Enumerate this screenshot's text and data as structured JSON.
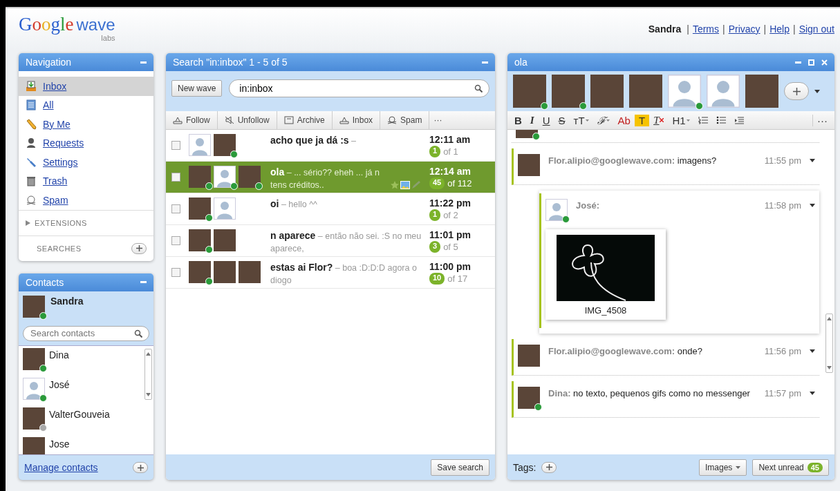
{
  "header": {
    "logo": {
      "brand": "Google",
      "product": "wave",
      "tag": "labs"
    },
    "user": "Sandra",
    "separator": "|",
    "links": [
      "Terms",
      "Privacy",
      "Help",
      "Sign out"
    ]
  },
  "navigation": {
    "title": "Navigation",
    "items": [
      {
        "label": "Inbox",
        "kind": "inbox",
        "selected": true
      },
      {
        "label": "All",
        "kind": "all",
        "selected": false
      },
      {
        "label": "By Me",
        "kind": "byme",
        "selected": false
      },
      {
        "label": "Requests",
        "kind": "requests",
        "selected": false
      },
      {
        "label": "Settings",
        "kind": "settings",
        "selected": false
      },
      {
        "label": "Trash",
        "kind": "trash",
        "selected": false
      },
      {
        "label": "Spam",
        "kind": "spam",
        "selected": false
      }
    ],
    "extensions": {
      "label": "EXTENSIONS",
      "expanded": false
    },
    "searches": "SEARCHES"
  },
  "contacts": {
    "title": "Contacts",
    "me": {
      "name": "Sandra",
      "kind": "photo",
      "online": true
    },
    "search_placeholder": "Search contacts",
    "list": [
      {
        "name": "Dina",
        "kind": "photo",
        "online": true
      },
      {
        "name": "José",
        "kind": "silhouette",
        "online": true
      },
      {
        "name": "ValterGouveia",
        "kind": "photo",
        "online": false
      },
      {
        "name": "Jose",
        "kind": "photo"
      }
    ],
    "manage_link": "Manage contacts"
  },
  "search": {
    "title": "Search \"in:inbox\" 1 - 5 of 5",
    "new_wave": "New wave",
    "query": "in:inbox",
    "toolbar": [
      {
        "label": "Follow",
        "kind": "follow"
      },
      {
        "label": "Unfollow",
        "kind": "unfollow"
      },
      {
        "label": "Archive",
        "kind": "archive"
      },
      {
        "label": "Inbox",
        "kind": "inbox"
      },
      {
        "label": "Spam",
        "kind": "spam"
      }
    ],
    "more": "···",
    "waves": [
      {
        "checked": false,
        "selected": false,
        "avatars": [
          {
            "kind": "silhouette",
            "online": false
          },
          {
            "kind": "photo",
            "online": true
          }
        ],
        "title": "acho que ja dá :s",
        "snippet": "–",
        "time": "12:11 am",
        "unread": "1",
        "total": "of 1"
      },
      {
        "checked": false,
        "selected": true,
        "avatars": [
          {
            "kind": "photo",
            "online": true
          },
          {
            "kind": "silhouette",
            "online": true
          },
          {
            "kind": "photo",
            "online": true
          }
        ],
        "title": "ola",
        "snippet": "– ... sério?? eheh ... já n tens créditos..",
        "attachments": [
          {
            "kind": "star"
          },
          {
            "kind": "image"
          },
          {
            "kind": "pencil"
          }
        ],
        "time": "12:14 am",
        "unread": "45",
        "total": "of 112"
      },
      {
        "checked": false,
        "selected": false,
        "avatars": [
          {
            "kind": "photo",
            "online": true
          },
          {
            "kind": "silhouette",
            "online": false
          }
        ],
        "title": "oi",
        "snippet": "– hello ^^",
        "time": "11:22 pm",
        "unread": "1",
        "total": "of 2"
      },
      {
        "checked": false,
        "selected": false,
        "avatars": [
          {
            "kind": "photo",
            "online": true
          },
          {
            "kind": "photo",
            "online": false
          }
        ],
        "title": "n aparece",
        "snippet": "– então não sei. :S no meu aparece,",
        "time": "11:01 pm",
        "unread": "3",
        "total": "of 5"
      },
      {
        "checked": false,
        "selected": false,
        "avatars": [
          {
            "kind": "photo",
            "online": true
          },
          {
            "kind": "photo",
            "online": false
          },
          {
            "kind": "photo",
            "online": false
          }
        ],
        "title": "estas ai Flor?",
        "snippet": "– boa :D:D:D agora o diogo",
        "time": "11:00 pm",
        "unread": "10",
        "total": "of 17"
      }
    ],
    "save_search": "Save search"
  },
  "wave": {
    "title": "ola",
    "participants": [
      {
        "kind": "photo",
        "online": true
      },
      {
        "kind": "photo",
        "online": true
      },
      {
        "kind": "photo",
        "online": false
      },
      {
        "kind": "photo",
        "online": false
      },
      {
        "kind": "silhouette",
        "online": true
      },
      {
        "kind": "silhouette",
        "online": false
      },
      {
        "kind": "photo",
        "online": false
      }
    ],
    "format_tools": [
      {
        "kind": "bold",
        "label": "B"
      },
      {
        "kind": "italic",
        "label": "I"
      },
      {
        "kind": "underline",
        "label": "U"
      },
      {
        "kind": "strike",
        "label": "S"
      },
      {
        "kind": "size",
        "label": "тT"
      },
      {
        "kind": "font",
        "label": "ℱ"
      },
      {
        "kind": "color",
        "label": "Ab"
      },
      {
        "kind": "highlight",
        "label": "T"
      },
      {
        "kind": "clear",
        "label": "T"
      },
      {
        "kind": "heading",
        "label": "H1"
      },
      {
        "kind": "numbered"
      },
      {
        "kind": "bulleted"
      },
      {
        "kind": "indent"
      }
    ],
    "more": "···",
    "top_avatar": {
      "kind": "photo",
      "online": true
    },
    "blips": [
      {
        "author": "Flor.alipio@googlewave.com:",
        "text": "imagens?",
        "time": "11:55 pm",
        "avatar": {
          "kind": "photo",
          "online": false
        },
        "children": [
          {
            "author": "José:",
            "time": "11:58 pm",
            "avatar": {
              "kind": "silhouette",
              "online": true
            },
            "attachment": {
              "caption": "IMG_4508"
            }
          }
        ]
      },
      {
        "author": "Flor.alipio@googlewave.com:",
        "text": "onde?",
        "time": "11:56 pm",
        "avatar": {
          "kind": "photo",
          "online": false
        }
      },
      {
        "author": "Dina:",
        "text": "no texto, pequenos gifs como no messenger",
        "time": "11:57 pm",
        "avatar": {
          "kind": "photo",
          "online": true
        }
      }
    ],
    "tags_label": "Tags:",
    "images_button": "Images",
    "next_unread": "Next unread",
    "next_unread_count": "45"
  }
}
